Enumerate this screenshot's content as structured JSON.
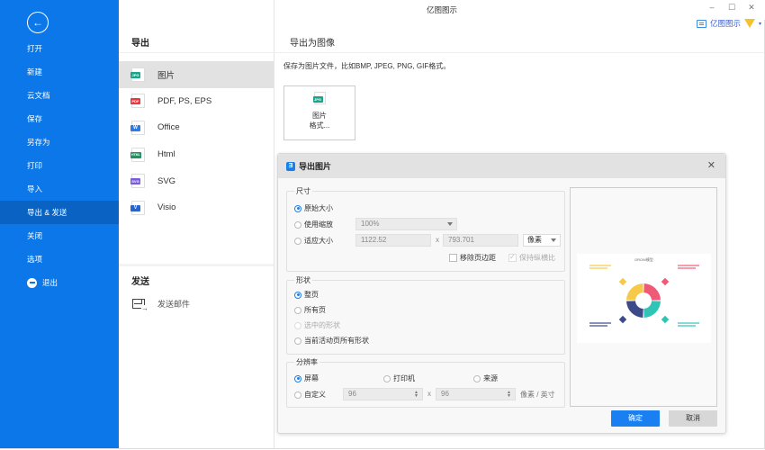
{
  "app": {
    "title": "亿图图示",
    "window_controls": {
      "minimize": "–",
      "maximize": "☐",
      "close": "✕"
    },
    "account_label": "亿图图示",
    "account_caret": "▾"
  },
  "sidebar": {
    "back_icon": "←",
    "items": [
      {
        "label": "打开"
      },
      {
        "label": "新建"
      },
      {
        "label": "云文档"
      },
      {
        "label": "保存"
      },
      {
        "label": "另存为"
      },
      {
        "label": "打印"
      },
      {
        "label": "导入"
      },
      {
        "label": "导出 & 发送",
        "active": true
      },
      {
        "label": "关闭"
      },
      {
        "label": "选项"
      },
      {
        "label": "退出",
        "icon": "minus-circle-icon"
      }
    ]
  },
  "export_section": {
    "title": "导出",
    "items": [
      {
        "label": "图片",
        "tag": "JPG",
        "color": "#1aa58a",
        "active": true
      },
      {
        "label": "PDF, PS, EPS",
        "tag": "PDF",
        "color": "#e8393f"
      },
      {
        "label": "Office",
        "tag": "W",
        "color": "#2f7be5"
      },
      {
        "label": "Html",
        "tag": "HTML",
        "color": "#1f9462"
      },
      {
        "label": "SVG",
        "tag": "SVG",
        "color": "#7a5be0"
      },
      {
        "label": "Visio",
        "tag": "V",
        "color": "#2a63c9"
      }
    ]
  },
  "send_section": {
    "title": "发送",
    "items": [
      {
        "label": "发送邮件"
      }
    ]
  },
  "right_panel": {
    "title": "导出为图像",
    "description": "保存为图片文件，比如BMP, JPEG, PNG, GIF格式。",
    "card": {
      "tag": "JPG",
      "line1": "图片",
      "line2": "格式..."
    }
  },
  "dialog": {
    "title": "导出图片",
    "logo": "Ǝ",
    "close": "✕",
    "size_group": {
      "legend": "尺寸",
      "options": [
        {
          "label": "原始大小",
          "checked": true
        },
        {
          "label": "使用缩放",
          "checked": false
        },
        {
          "label": "适应大小",
          "checked": false
        }
      ],
      "zoom_value": "100%",
      "width_value": "1122.52",
      "height_value": "793.701",
      "times": "x",
      "unit": "像素",
      "remove_margin_label": "移除页边距",
      "remove_margin_checked": false,
      "keep_ratio_label": "保持纵横比",
      "keep_ratio_checked": true
    },
    "shape_group": {
      "legend": "形状",
      "options": [
        {
          "label": "整页",
          "checked": true
        },
        {
          "label": "所有页",
          "checked": false
        },
        {
          "label": "选中的形状",
          "checked": false,
          "disabled": true
        },
        {
          "label": "当前活动页所有形状",
          "checked": false
        }
      ]
    },
    "resolution_group": {
      "legend": "分辨率",
      "options": [
        {
          "label": "屏幕",
          "checked": true
        },
        {
          "label": "打印机",
          "checked": false
        },
        {
          "label": "来源",
          "checked": false
        },
        {
          "label": "自定义",
          "checked": false
        }
      ],
      "dpi_x": "96",
      "dpi_y": "96",
      "times": "x",
      "unit": "像素 / 英寸"
    },
    "preview": {
      "diagram_title": "GROW模型",
      "segment_colors": [
        "#f7c948",
        "#ef5b77",
        "#2ec4b6",
        "#3d4a8a"
      ]
    },
    "ok_label": "确定",
    "cancel_label": "取消"
  }
}
